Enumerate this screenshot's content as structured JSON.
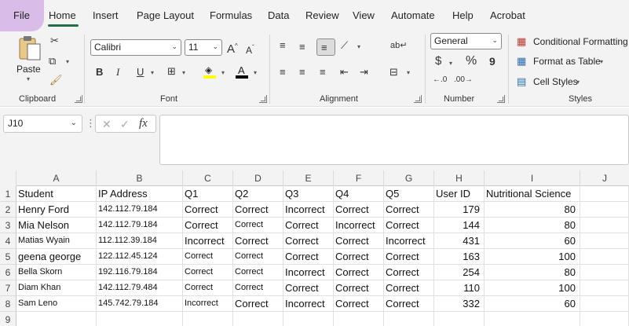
{
  "menu": {
    "items": [
      "File",
      "Home",
      "Insert",
      "Page Layout",
      "Formulas",
      "Data",
      "Review",
      "View",
      "Automate",
      "Help",
      "Acrobat"
    ]
  },
  "ribbon": {
    "clipboard": {
      "label": "Clipboard",
      "paste": "Paste"
    },
    "font": {
      "label": "Font",
      "font_name": "Calibri",
      "font_size": "11",
      "bold": "B",
      "italic": "I",
      "underline": "U",
      "grow": "A",
      "shrink": "A"
    },
    "alignment": {
      "label": "Alignment"
    },
    "number": {
      "label": "Number",
      "format": "General",
      "currency": "$",
      "percent": "%",
      "comma": "9"
    },
    "styles": {
      "label": "Styles",
      "conditional": "Conditional Formatting",
      "format_table": "Format as Table",
      "cell_styles": "Cell Styles"
    }
  },
  "formula_bar": {
    "name_box": "J10",
    "fx": "fx",
    "value": ""
  },
  "sheet": {
    "columns": [
      "A",
      "B",
      "C",
      "D",
      "E",
      "F",
      "G",
      "H",
      "I",
      "J"
    ],
    "rows": [
      "1",
      "2",
      "3",
      "4",
      "5",
      "6",
      "7",
      "8",
      "9"
    ],
    "header": [
      "Student",
      "IP Address",
      "Q1",
      "Q2",
      "Q3",
      "Q4",
      "Q5",
      "User ID",
      "Nutritional Science"
    ],
    "data": [
      [
        "Henry Ford",
        "142.112.79.184",
        "Correct",
        "Correct",
        "Incorrect",
        "Correct",
        "Correct",
        "179",
        "80"
      ],
      [
        "Mia Nelson",
        "142.112.79.184",
        "Correct",
        "Correct",
        "Correct",
        "Incorrect",
        "Correct",
        "144",
        "80"
      ],
      [
        "Matias Wyain",
        "112.112.39.184",
        "Incorrect",
        "Correct",
        "Correct",
        "Correct",
        "Incorrect",
        "431",
        "60"
      ],
      [
        "geena george",
        "122.112.45.124",
        "Correct",
        "Correct",
        "Correct",
        "Correct",
        "Correct",
        "163",
        "100"
      ],
      [
        "Bella Skorn",
        "192.116.79.184",
        "Correct",
        "Correct",
        "Incorrect",
        "Correct",
        "Correct",
        "254",
        "80"
      ],
      [
        "Diam Khan",
        "142.112.79.484",
        "Correct",
        "Correct",
        "Correct",
        "Correct",
        "Correct",
        "110",
        "100"
      ],
      [
        "Sam Leno",
        "145.742.79.184",
        "Incorrect",
        "Correct",
        "Incorrect",
        "Correct",
        "Correct",
        "332",
        "60"
      ]
    ]
  },
  "colors": {
    "accent": "#1e7145",
    "file_highlight": "#d9bde8",
    "ribbon_bg": "#f3f3f3"
  }
}
